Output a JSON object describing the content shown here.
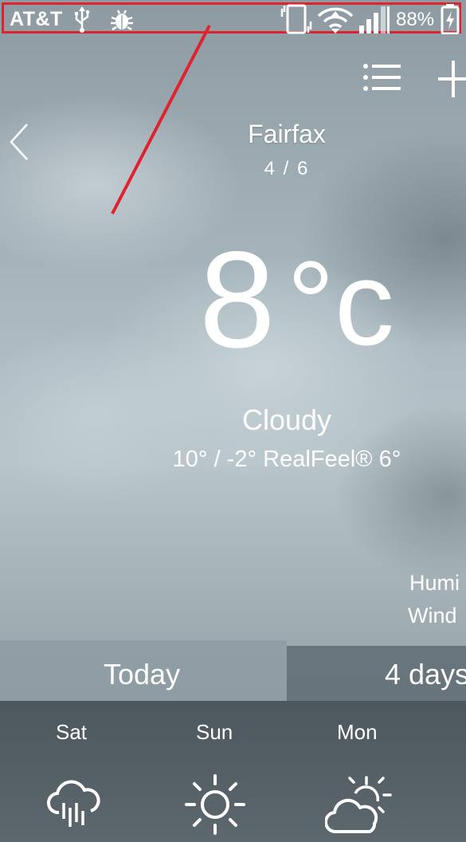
{
  "status_bar": {
    "carrier": "AT&T",
    "icons": [
      "usb-icon",
      "android-debug-icon",
      "vibrate-icon",
      "wifi-icon",
      "signal-icon",
      "battery-charging-icon"
    ],
    "battery_percent": "88%",
    "highlight_color": "#e0222e"
  },
  "toolbar": {
    "icons": [
      "list-icon",
      "add-icon"
    ]
  },
  "location": {
    "city": "Fairfax",
    "page_indicator": "4 / 6",
    "nav_icon": "chevron-left-icon"
  },
  "current": {
    "temp_value": "8",
    "temp_unit": "°c",
    "condition": "Cloudy",
    "range": "10° / -2° RealFeel® 6°"
  },
  "details": {
    "humidity_label": "Humi",
    "wind_label": "Wind"
  },
  "tabs": [
    {
      "label": "Today",
      "selected": false
    },
    {
      "label": "4 days",
      "selected": true
    }
  ],
  "forecast": [
    {
      "day": "Sat",
      "icon": "rain-cloud-icon"
    },
    {
      "day": "Sun",
      "icon": "sun-icon"
    },
    {
      "day": "Mon",
      "icon": "partly-cloudy-icon"
    }
  ]
}
